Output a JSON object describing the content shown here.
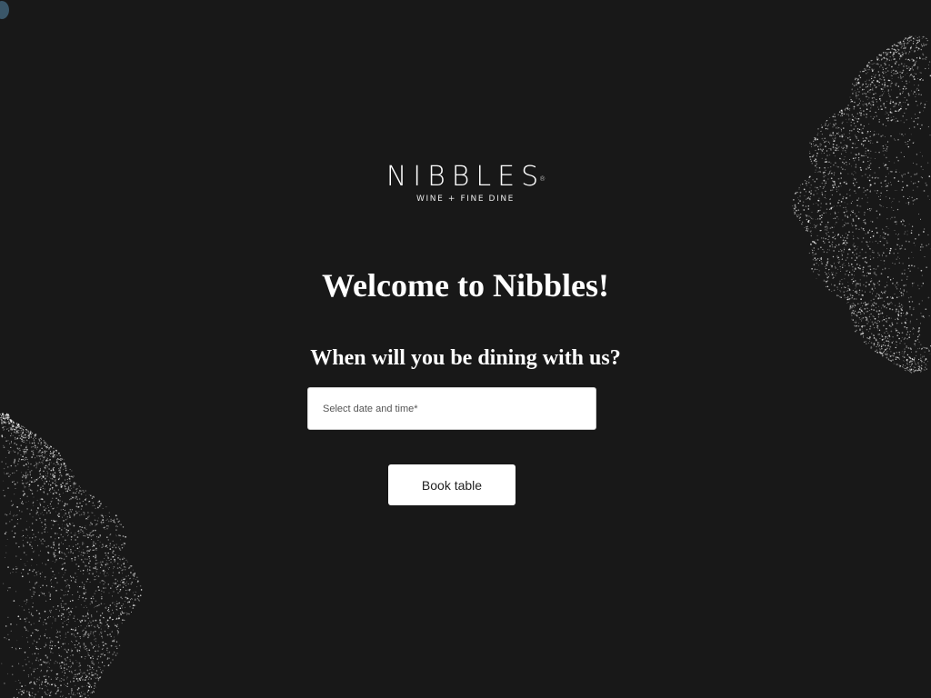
{
  "brand": {
    "name": "NIBBLES",
    "registered_mark": "®",
    "tagline": "WINE + FINE DINE"
  },
  "hero": {
    "welcome_heading": "Welcome to Nibbles!",
    "question": "When will you be dining with us?"
  },
  "booking": {
    "date_placeholder": "Select date and time*",
    "book_button_label": "Book table"
  },
  "colors": {
    "background": "#181818",
    "text": "#ffffff",
    "button_background": "#ffffff",
    "button_text": "#222222",
    "speckle": "#ffffff",
    "corner_dot": "#3a5668"
  },
  "decor": {
    "icons": [
      "speckle-texture-top-right",
      "speckle-texture-bottom-left"
    ]
  }
}
